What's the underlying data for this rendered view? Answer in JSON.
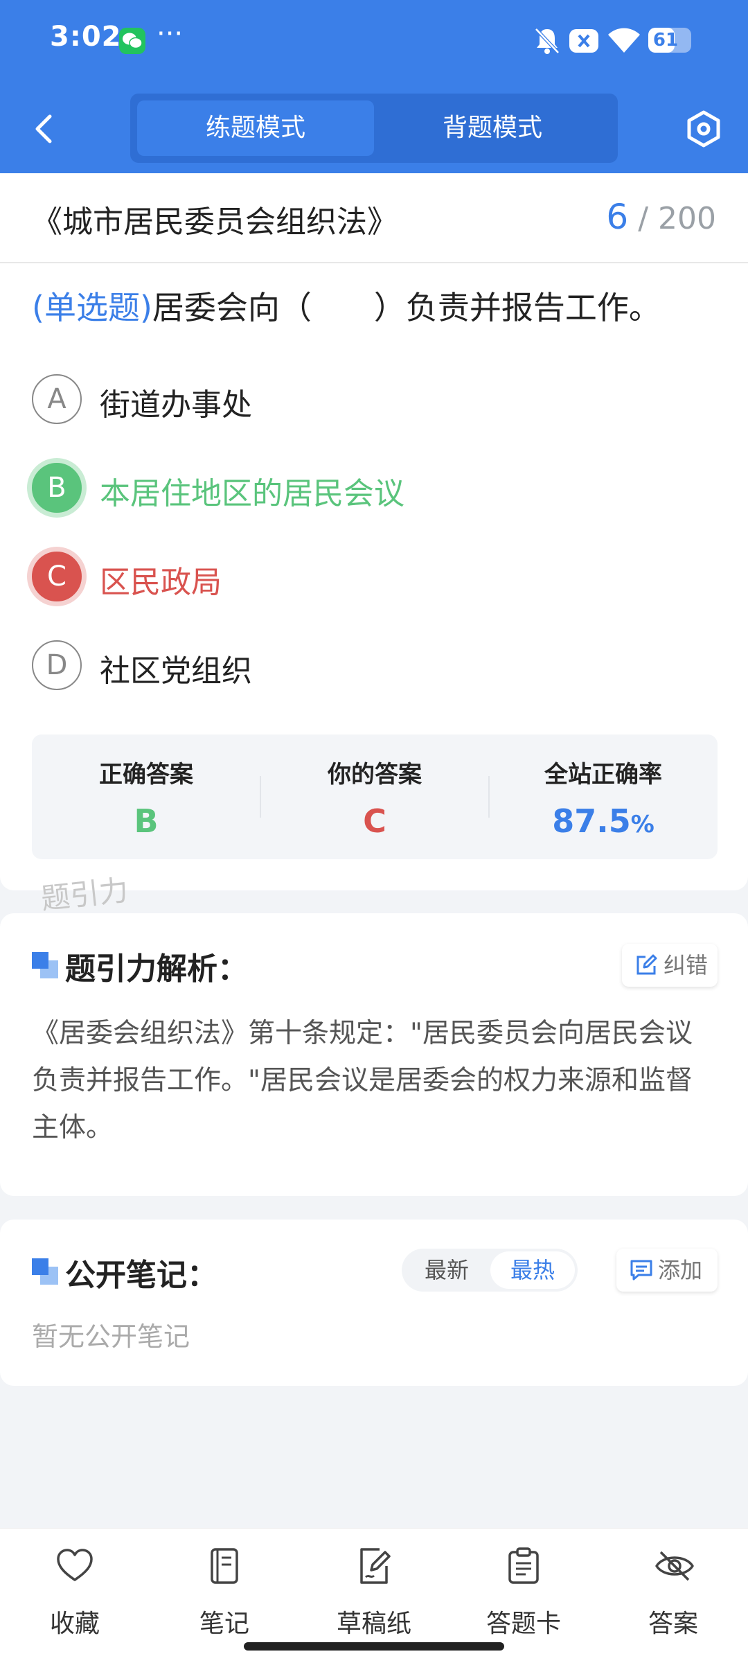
{
  "status_bar": {
    "time": "3:02",
    "more": "···",
    "battery_level": "61",
    "battery_fraction": 0.61
  },
  "header": {
    "modes": [
      "练题模式",
      "背题模式"
    ],
    "active_mode": "练题模式"
  },
  "question": {
    "book_title": "《城市居民委员会组织法》",
    "current": "6",
    "separator": "/",
    "total": "200",
    "type_label": "(单选题)",
    "stem_before": "居委会向（",
    "stem_after": "）负责并报告工作。",
    "options": [
      {
        "letter": "A",
        "text": "街道办事处",
        "state": "normal"
      },
      {
        "letter": "B",
        "text": "本居住地区的居民会议",
        "state": "correct"
      },
      {
        "letter": "C",
        "text": "区民政局",
        "state": "wrong"
      },
      {
        "letter": "D",
        "text": "社区党组织",
        "state": "normal"
      }
    ],
    "summary": {
      "correct_label": "正确答案",
      "correct_value": "B",
      "yours_label": "你的答案",
      "yours_value": "C",
      "rate_label": "全站正确率",
      "rate_value": "87.5",
      "rate_unit": "%"
    },
    "watermark": "题引力"
  },
  "analysis": {
    "title": "题引力解析：",
    "report_button": "纠错",
    "text": "《居委会组织法》第十条规定：\"居民委员会向居民会议负责并报告工作。\"居民会议是居委会的权力来源和监督主体。"
  },
  "notes": {
    "title": "公开笔记：",
    "sort_latest": "最新",
    "sort_hot": "最热",
    "add_button": "添加",
    "empty": "暂无公开笔记"
  },
  "bottom_nav": {
    "favorite": "收藏",
    "notes": "笔记",
    "scratch": "草稿纸",
    "answer_card": "答题卡",
    "answer": "答案"
  },
  "colors": {
    "primary": "#3b7fe8",
    "correct": "#5ac47c",
    "wrong": "#d9534f"
  }
}
